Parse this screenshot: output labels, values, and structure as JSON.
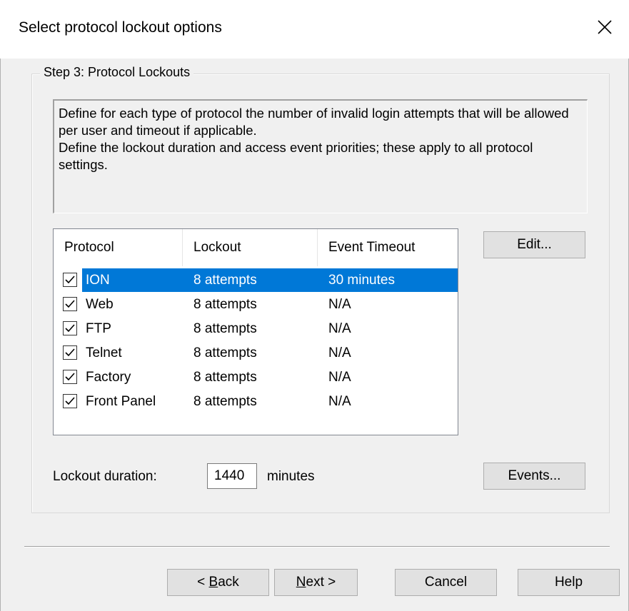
{
  "dialog": {
    "title": "Select protocol lockout options"
  },
  "group": {
    "legend": "Step 3: Protocol Lockouts",
    "description_line1": "Define for each type of protocol the number of invalid login attempts that will be allowed per user and timeout if applicable.",
    "description_line2": "Define the lockout duration and access event priorities; these apply to all protocol settings."
  },
  "table": {
    "columns": [
      "Protocol",
      "Lockout",
      "Event Timeout"
    ],
    "rows": [
      {
        "protocol": "ION",
        "lockout": "8 attempts",
        "timeout": "30 minutes",
        "checked": true,
        "selected": true
      },
      {
        "protocol": "Web",
        "lockout": "8 attempts",
        "timeout": "N/A",
        "checked": true,
        "selected": false
      },
      {
        "protocol": "FTP",
        "lockout": "8 attempts",
        "timeout": "N/A",
        "checked": true,
        "selected": false
      },
      {
        "protocol": "Telnet",
        "lockout": "8 attempts",
        "timeout": "N/A",
        "checked": true,
        "selected": false
      },
      {
        "protocol": "Factory",
        "lockout": "8 attempts",
        "timeout": "N/A",
        "checked": true,
        "selected": false
      },
      {
        "protocol": "Front Panel",
        "lockout": "8 attempts",
        "timeout": "N/A",
        "checked": true,
        "selected": false
      }
    ]
  },
  "buttons": {
    "edit": "Edit...",
    "events": "Events...",
    "back_prefix": "< ",
    "back_mnemonic": "B",
    "back_rest": "ack",
    "next_mnemonic": "N",
    "next_rest": "ext >",
    "cancel": "Cancel",
    "help": "Help"
  },
  "lockout": {
    "label": "Lockout duration:",
    "value": "1440",
    "unit": "minutes"
  },
  "icons": {
    "close": "close-icon",
    "check": "checkmark-icon"
  },
  "colors": {
    "selection": "#0078d7",
    "background": "#f0f0f0",
    "button_face": "#e1e1e1"
  }
}
